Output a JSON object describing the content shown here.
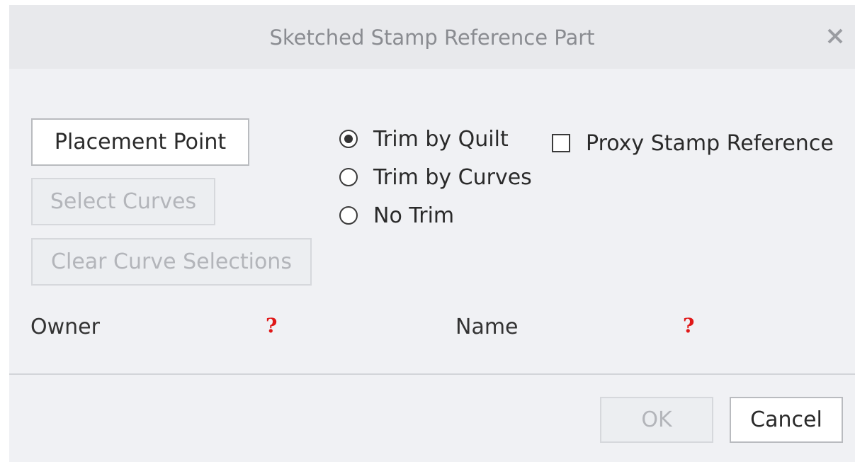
{
  "dialog": {
    "title": "Sketched Stamp Reference Part"
  },
  "buttons": {
    "placement_point": "Placement Point",
    "select_curves": "Select Curves",
    "clear_curve_selections": "Clear Curve Selections",
    "ok": "OK",
    "cancel": "Cancel"
  },
  "trim_options": [
    {
      "label": "Trim by Quilt",
      "selected": true
    },
    {
      "label": "Trim by Curves",
      "selected": false
    },
    {
      "label": "No Trim",
      "selected": false
    }
  ],
  "proxy": {
    "label": "Proxy Stamp Reference",
    "checked": false
  },
  "fields": {
    "owner_label": "Owner",
    "owner_value": "?",
    "name_label": "Name",
    "name_value": "?"
  },
  "colors": {
    "background": "#f0f1f4",
    "titlebar": "#e8e9ec",
    "missing_value": "#e01818"
  },
  "icons": {
    "close": "close-icon"
  }
}
